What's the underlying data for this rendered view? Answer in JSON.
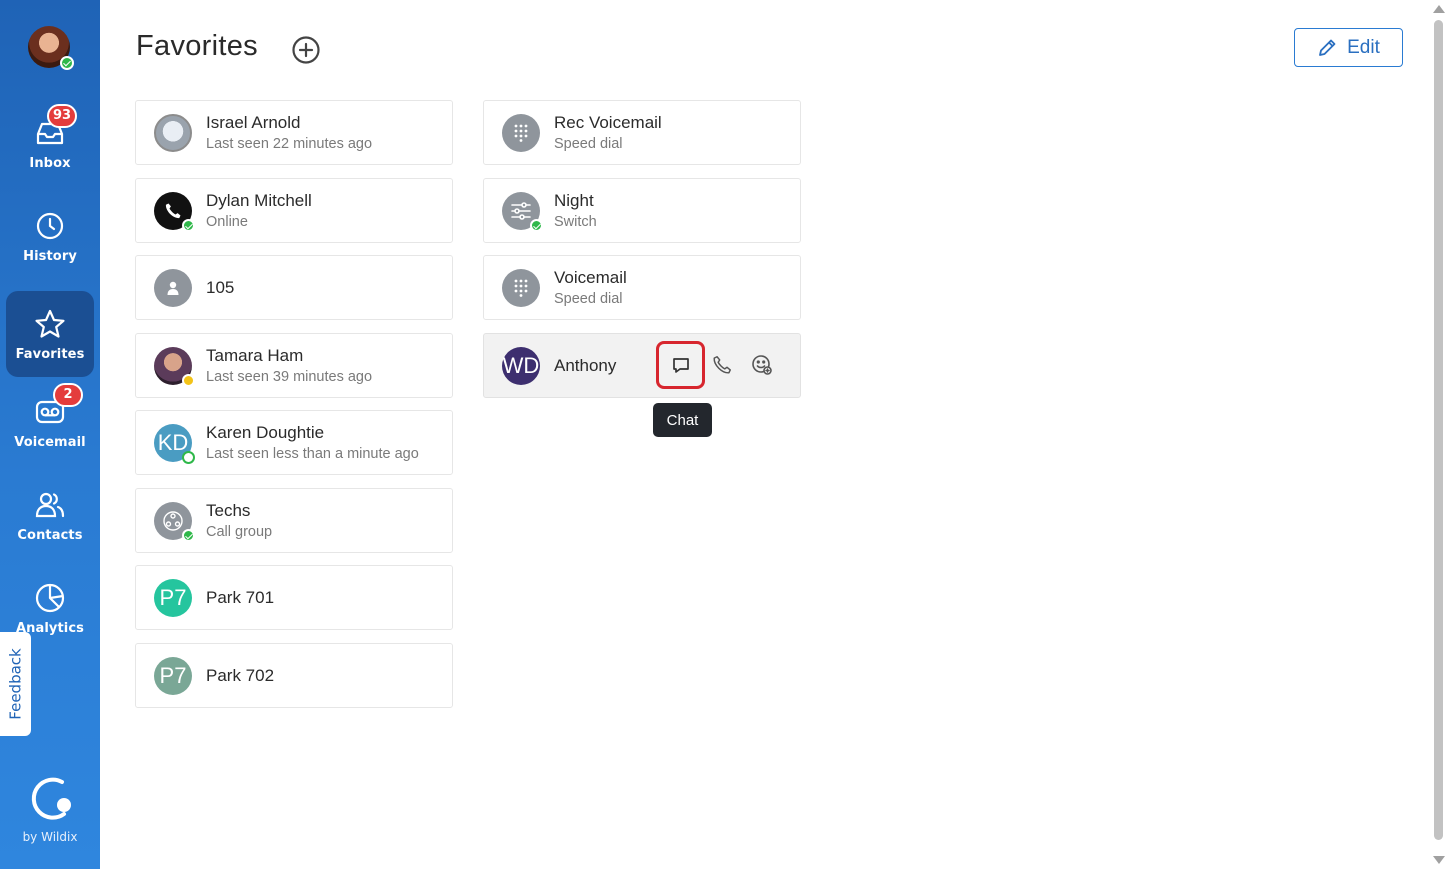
{
  "sidebar": {
    "items": [
      {
        "label": "Inbox",
        "icon": "inbox-icon",
        "badge": "93"
      },
      {
        "label": "History",
        "icon": "clock-icon"
      },
      {
        "label": "Favorites",
        "icon": "star-icon",
        "active": true
      },
      {
        "label": "Voicemail",
        "icon": "voicemail-icon",
        "badge": "2"
      },
      {
        "label": "Contacts",
        "icon": "contacts-icon"
      },
      {
        "label": "Analytics",
        "icon": "pie-chart-icon"
      }
    ],
    "feedback_label": "Feedback",
    "brand_by": "by Wildix"
  },
  "header": {
    "title": "Favorites",
    "edit_label": "Edit"
  },
  "favorites_left": [
    {
      "name": "Israel Arnold",
      "sub": "Last seen 22 minutes ago",
      "avatar": "photo"
    },
    {
      "name": "Dylan Mitchell",
      "sub": "Online",
      "avatar": "phone-icon",
      "status": "online"
    },
    {
      "name": "105",
      "sub": "",
      "avatar": "person-icon"
    },
    {
      "name": "Tamara Ham",
      "sub": "Last seen 39 minutes ago",
      "avatar": "photo",
      "status": "away"
    },
    {
      "name": "Karen Doughtie",
      "sub": "Last seen less than a minute ago",
      "initials": "KD",
      "status": "ring"
    },
    {
      "name": "Techs",
      "sub": "Call group",
      "avatar": "call-group-icon",
      "status": "online"
    },
    {
      "name": "Park 701",
      "sub": "",
      "initials": "P7"
    },
    {
      "name": "Park 702",
      "sub": "",
      "initials": "P7"
    }
  ],
  "favorites_right": [
    {
      "name": "Rec Voicemail",
      "sub": "Speed dial",
      "avatar": "dialpad-icon"
    },
    {
      "name": "Night",
      "sub": "Switch",
      "avatar": "switch-icon",
      "status": "online"
    },
    {
      "name": "Voicemail",
      "sub": "Speed dial",
      "avatar": "dialpad-icon"
    },
    {
      "name": "Anthony",
      "sub": "",
      "initials": "WD"
    }
  ],
  "tooltip": "Chat",
  "colors": {
    "sidebar": "#2a7bd2",
    "accent": "#2a6fc0",
    "highlight": "#d7262e",
    "online": "#2fb84a",
    "away": "#f3c318",
    "badge": "#e43c3c"
  }
}
